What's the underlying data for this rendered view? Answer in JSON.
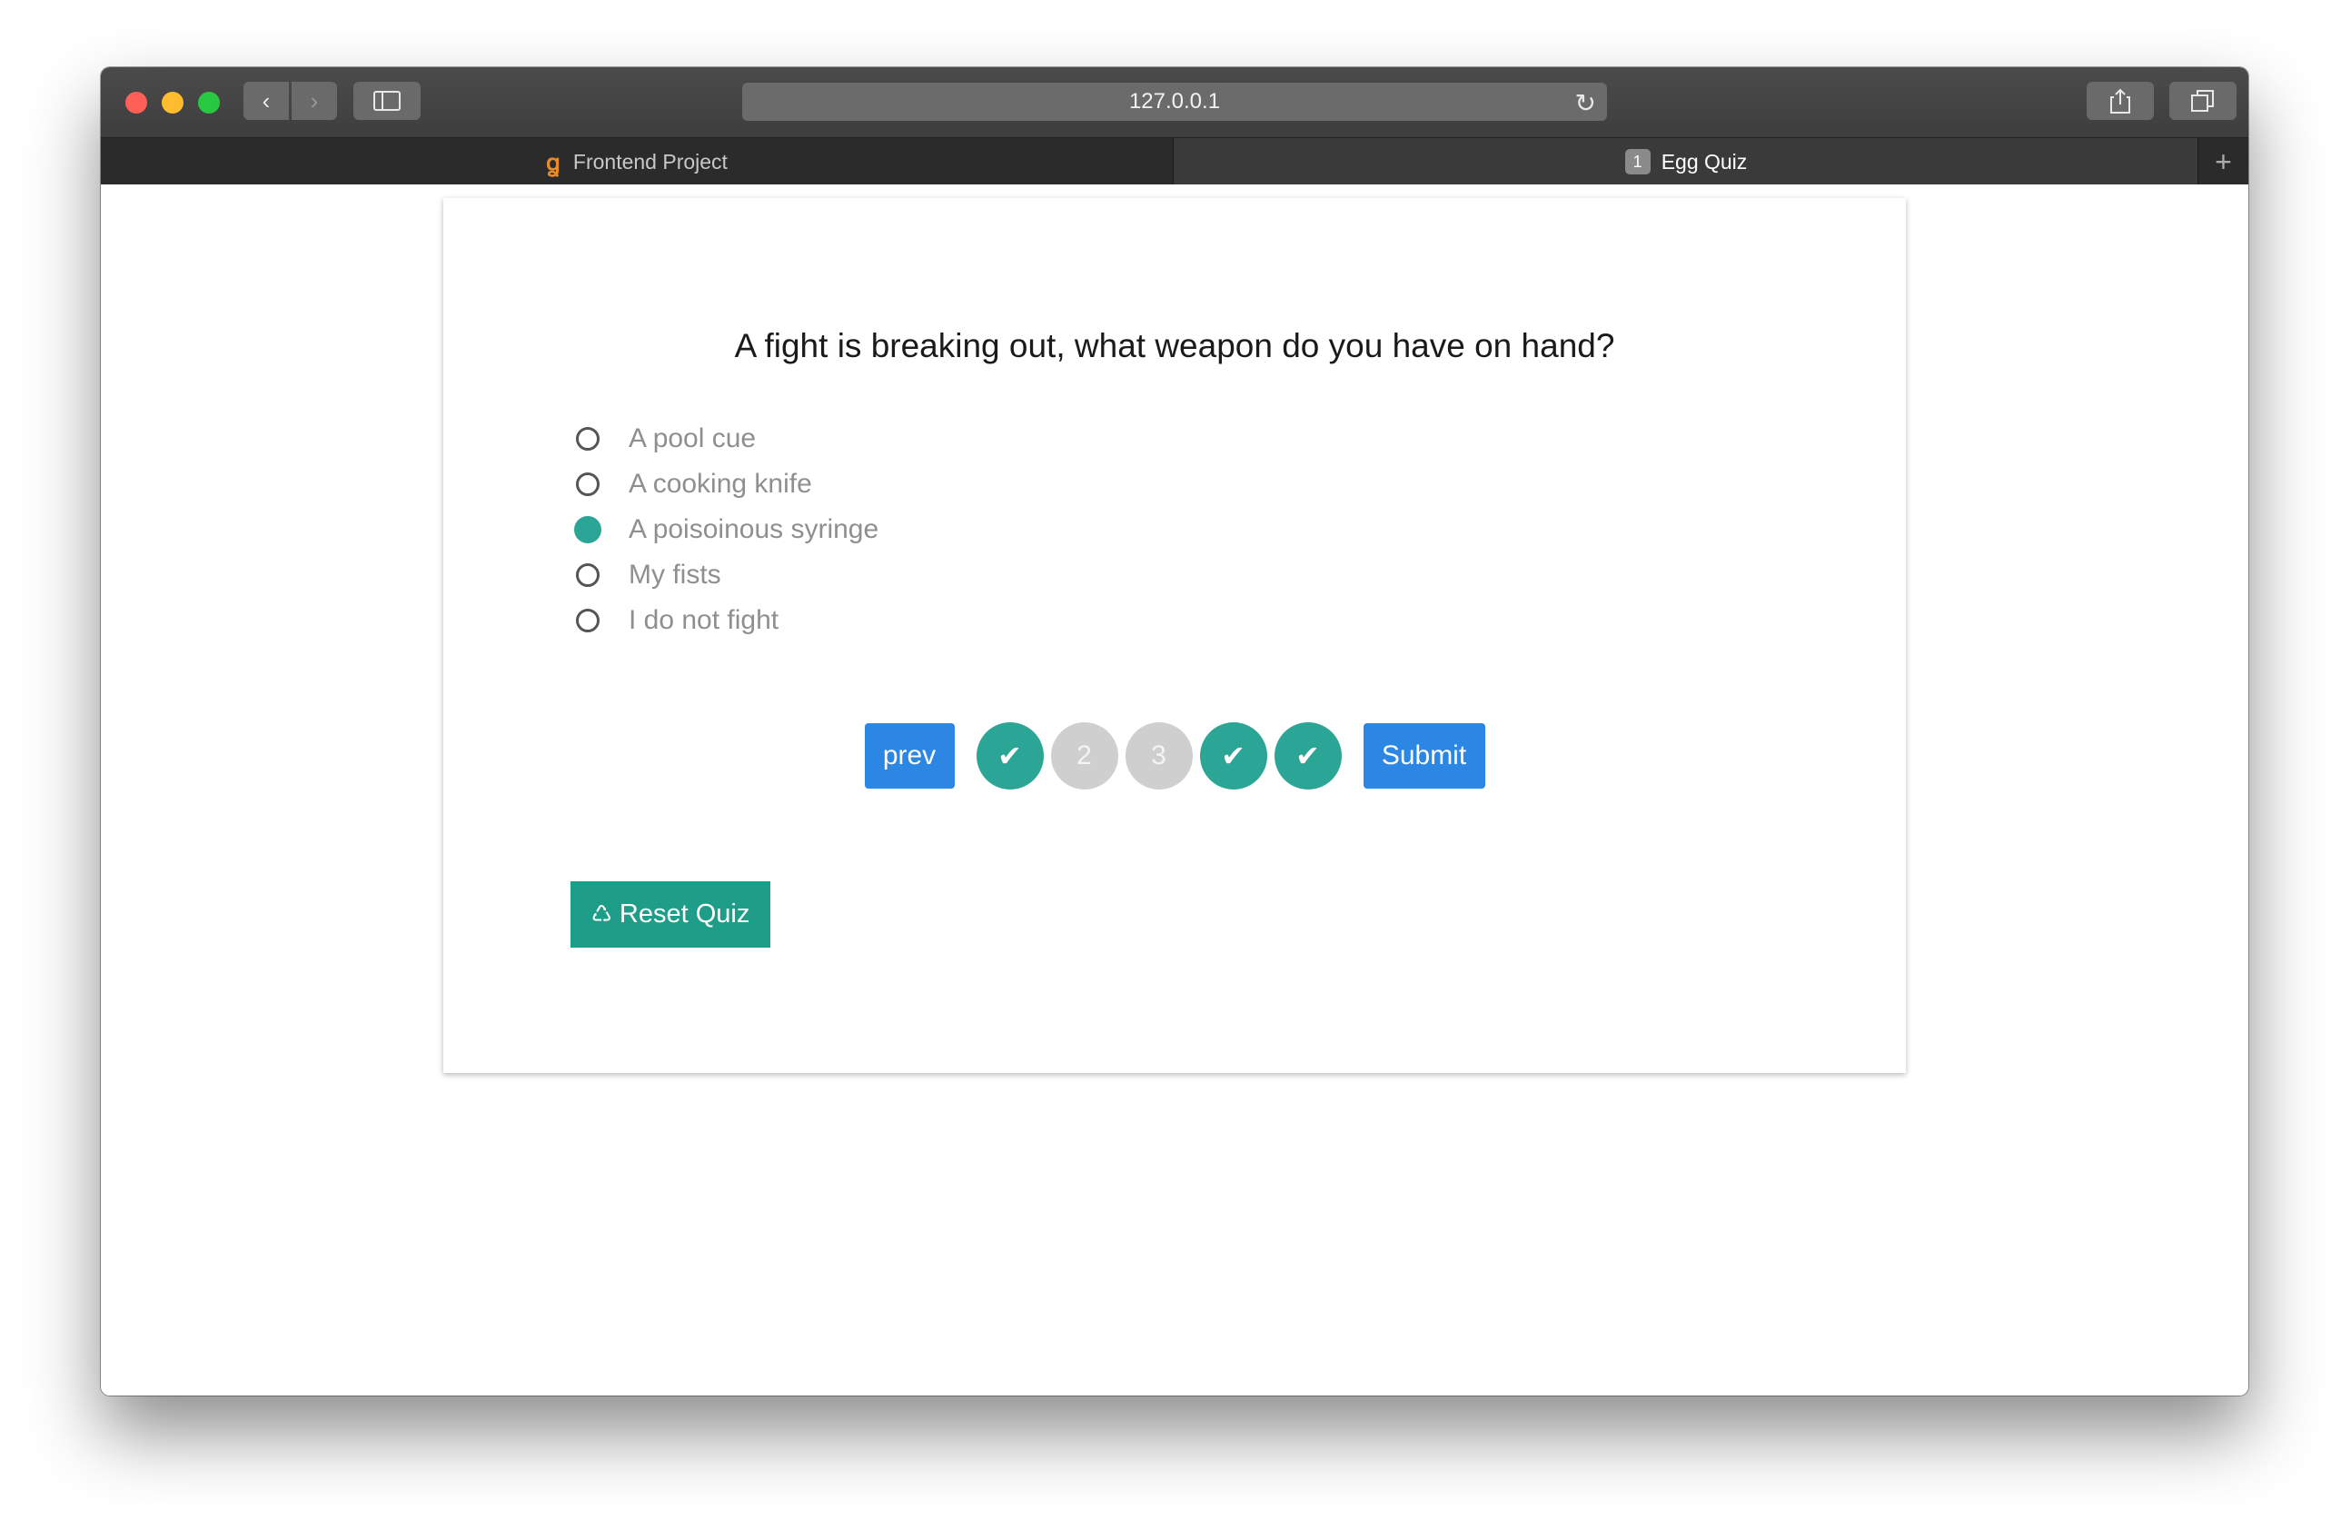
{
  "browser": {
    "url": "127.0.0.1",
    "tabs": [
      {
        "label": "Frontend Project"
      },
      {
        "label": "Egg Quiz",
        "badge": "1"
      }
    ]
  },
  "quiz": {
    "question": "A fight is breaking out, what weapon do you have on hand?",
    "options": [
      {
        "label": "A pool cue",
        "selected": false
      },
      {
        "label": "A cooking knife",
        "selected": false
      },
      {
        "label": "A poisoinous syringe",
        "selected": true
      },
      {
        "label": "My fists",
        "selected": false
      },
      {
        "label": "I do not fight",
        "selected": false
      }
    ],
    "pager": {
      "prev_label": "prev",
      "submit_label": "Submit",
      "steps": [
        {
          "label": "✔",
          "answered": true
        },
        {
          "label": "2",
          "answered": false
        },
        {
          "label": "3",
          "answered": false
        },
        {
          "label": "✔",
          "answered": true
        },
        {
          "label": "✔",
          "answered": true
        }
      ]
    },
    "reset_label": "Reset Quiz"
  },
  "colors": {
    "accent_teal": "#2ba596",
    "button_blue": "#2b86e4",
    "reset_green": "#1e9d88"
  }
}
